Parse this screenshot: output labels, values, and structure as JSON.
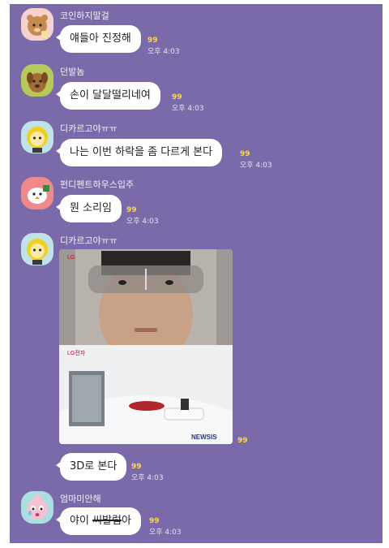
{
  "messages": [
    {
      "name": "코인하지말걸",
      "text": "얘들아 진정해",
      "unread": "99",
      "time": "오후 4:03"
    },
    {
      "name": "던발놈",
      "text": "손이 달달떨리네여",
      "unread": "99",
      "time": "오후 4:03"
    },
    {
      "name": "디카르고야ㅠㅠ",
      "text": "나는 이번 하락을 좀 다르게 본다",
      "unread": "99",
      "time": "오후 4:03"
    },
    {
      "name": "펀디펜트하우스입주",
      "text": "뭔 소리임",
      "unread": "99",
      "time": "오후 4:03"
    },
    {
      "name": "디카르고야ㅠㅠ",
      "photo_logo_top": "LG",
      "photo_logo_mid": "LG전자",
      "photo_watermark": "NEWSIS",
      "unread": "99"
    },
    {
      "text": "3D로 본다",
      "unread": "99",
      "time": "오후 4:03"
    },
    {
      "name": "엄마미안해",
      "text_a": "야이 ",
      "text_struck": "씨발럼",
      "text_b": "아",
      "unread": "99",
      "time": "오후 4:03"
    }
  ],
  "icons": [
    "bear-avatar-icon",
    "puppy-avatar-icon",
    "round-face-avatar-icon",
    "bird-avatar-icon",
    "round-face-avatar-icon",
    "crying-girl-avatar-icon"
  ],
  "colors": {
    "chat_background": "#7b6aa9",
    "bubble": "#ffffff",
    "unread": "#ffd84a"
  }
}
